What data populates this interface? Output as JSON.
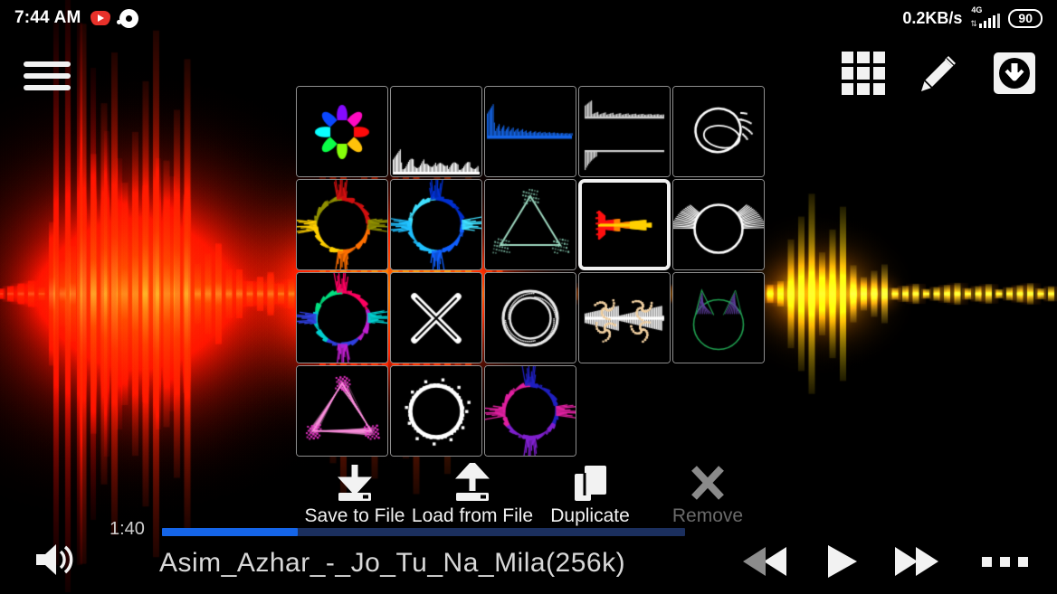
{
  "status_bar": {
    "clock": "7:44 AM",
    "network_speed": "0.2KB/s",
    "network_type": "4G",
    "battery_level": "90",
    "icons": [
      "youtube-music-icon",
      "disc-notification-icon",
      "signal-icon",
      "battery-icon"
    ]
  },
  "top_bar": {
    "menu_icon": "hamburger-menu-icon",
    "actions": [
      {
        "name": "grid-view-icon",
        "label": "Grid"
      },
      {
        "name": "edit-pencil-icon",
        "label": "Edit"
      },
      {
        "name": "download-icon",
        "label": "Download"
      }
    ]
  },
  "preset_grid": {
    "selected_index": 8,
    "columns": 5,
    "cells": [
      {
        "index": 0,
        "name": "preset-rainbow-flower",
        "style": "flower",
        "colors": [
          "#ff0000",
          "#ffff00",
          "#00ff00",
          "#00ffff",
          "#0000ff",
          "#ff00ff"
        ]
      },
      {
        "index": 1,
        "name": "preset-white-spectrum-low",
        "style": "spectrum-bottom",
        "colors": [
          "#ffffff"
        ]
      },
      {
        "index": 2,
        "name": "preset-blue-spectrum-top",
        "style": "spectrum-top",
        "colors": [
          "#1565e8"
        ]
      },
      {
        "index": 3,
        "name": "preset-dual-gray-lines",
        "style": "dual-lines",
        "colors": [
          "#d0d0d0"
        ]
      },
      {
        "index": 4,
        "name": "preset-white-tilted-ring",
        "style": "tilted-ring",
        "colors": [
          "#ffffff"
        ]
      },
      {
        "index": 5,
        "name": "preset-warm-circle",
        "style": "circle-spikes",
        "colors": [
          "#d01010",
          "#ff7000",
          "#ffd000",
          "#909000"
        ]
      },
      {
        "index": 6,
        "name": "preset-blue-circle",
        "style": "circle-spikes",
        "colors": [
          "#0030d0",
          "#1060ff",
          "#20c0ff",
          "#40e0ff"
        ]
      },
      {
        "index": 7,
        "name": "preset-green-triangle",
        "style": "triangle",
        "colors": [
          "#9fd8c0",
          "#7fc0a8"
        ]
      },
      {
        "index": 8,
        "name": "preset-fire-linear",
        "style": "linear-fire",
        "colors": [
          "#ff1010",
          "#ff8000",
          "#ffd000"
        ]
      },
      {
        "index": 9,
        "name": "preset-white-winged-ring",
        "style": "winged-ring",
        "colors": [
          "#ffffff"
        ]
      },
      {
        "index": 10,
        "name": "preset-neon-circle",
        "style": "circle-spikes",
        "colors": [
          "#ff0060",
          "#c020d0",
          "#3040e0",
          "#00d0d0",
          "#00e080"
        ]
      },
      {
        "index": 11,
        "name": "preset-white-x",
        "style": "letter-x",
        "colors": [
          "#ffffff"
        ]
      },
      {
        "index": 12,
        "name": "preset-double-ring",
        "style": "double-ring",
        "colors": [
          "#e8e8e8"
        ]
      },
      {
        "index": 13,
        "name": "preset-tan-symmetric",
        "style": "symmetric-burst",
        "colors": [
          "#f0cfa0",
          "#ffffff"
        ]
      },
      {
        "index": 14,
        "name": "preset-green-cat",
        "style": "cat-ears",
        "colors": [
          "#20a050",
          "#6040a0"
        ]
      },
      {
        "index": 15,
        "name": "preset-pink-triangle",
        "style": "filled-triangle",
        "colors": [
          "#ff90e0",
          "#e030c0"
        ]
      },
      {
        "index": 16,
        "name": "preset-white-dotted-ring",
        "style": "dotted-ring",
        "colors": [
          "#ffffff"
        ]
      },
      {
        "index": 17,
        "name": "preset-purple-circle",
        "style": "circle-spikes",
        "colors": [
          "#2020c0",
          "#8020d0",
          "#e020a0"
        ]
      }
    ]
  },
  "file_actions": [
    {
      "name": "save-to-file-button",
      "label": "Save to File",
      "icon": "save-download-icon",
      "enabled": true
    },
    {
      "name": "load-from-file-button",
      "label": "Load from File",
      "icon": "load-upload-icon",
      "enabled": true
    },
    {
      "name": "duplicate-button",
      "label": "Duplicate",
      "icon": "duplicate-icon",
      "enabled": true
    },
    {
      "name": "remove-button",
      "label": "Remove",
      "icon": "close-x-icon",
      "enabled": false
    }
  ],
  "player": {
    "elapsed_time": "1:40",
    "progress_percent": 26,
    "track_title": "Asim_Azhar_-_Jo_Tu_Na_Mila(256k)",
    "volume_icon": "volume-speaker-icon",
    "transport": [
      {
        "name": "rewind-button",
        "icon": "rewind-icon"
      },
      {
        "name": "play-button",
        "icon": "play-icon"
      },
      {
        "name": "fast-forward-button",
        "icon": "fast-forward-icon"
      },
      {
        "name": "more-options-button",
        "icon": "overflow-dots-icon"
      }
    ]
  },
  "colors": {
    "progress_fill": "#1565e8",
    "progress_track": "#1b2f5e",
    "accent_wave_left": "#ff1a00",
    "accent_wave_right": "#ffc000",
    "disabled_text": "#6a6a6a",
    "text": "#f2f2f2",
    "background": "#000000"
  }
}
